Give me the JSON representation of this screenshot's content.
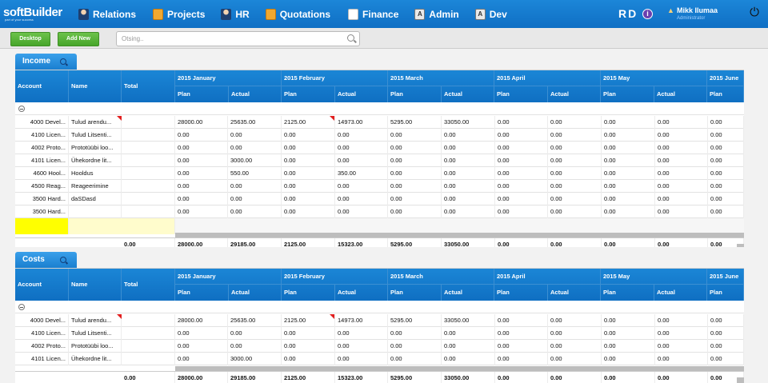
{
  "brand": {
    "name": "softBuilder",
    "tagline": "part of your success"
  },
  "nav": {
    "items": [
      {
        "label": "Relations",
        "icon": "person-icon"
      },
      {
        "label": "Projects",
        "icon": "projects-icon"
      },
      {
        "label": "HR",
        "icon": "person-icon"
      },
      {
        "label": "Quotations",
        "icon": "quotations-icon"
      },
      {
        "label": "Finance",
        "icon": "document-icon"
      },
      {
        "label": "Admin",
        "icon": "admin-icon"
      },
      {
        "label": "Dev",
        "icon": "dev-icon"
      }
    ],
    "initials": "RD",
    "info_glyph": "i",
    "user_name": "Mikk Ilumaa",
    "user_role": "Administrator"
  },
  "toolbar": {
    "desktop_label": "Desktop",
    "add_new_label": "Add New",
    "search_placeholder": "Otsing.."
  },
  "income": {
    "title": "Income",
    "headers": {
      "account": "Account",
      "name": "Name",
      "total": "Total",
      "months": [
        "2015 January",
        "2015 February",
        "2015 March",
        "2015 April",
        "2015 May",
        "2015 June"
      ],
      "plan": "Plan",
      "actual": "Actual"
    },
    "rows": [
      {
        "account": "4000 Devel...",
        "name": "Tulud arendu...",
        "total": "",
        "values": [
          "28000.00",
          "25635.00",
          "2125.00",
          "14973.00",
          "5295.00",
          "33050.00",
          "0.00",
          "0.00",
          "0.00",
          "0.00",
          "0.00"
        ]
      },
      {
        "account": "4100 Licen...",
        "name": "Tulud Litsenti...",
        "total": "",
        "values": [
          "0.00",
          "0.00",
          "0.00",
          "0.00",
          "0.00",
          "0.00",
          "0.00",
          "0.00",
          "0.00",
          "0.00",
          "0.00"
        ]
      },
      {
        "account": "4002 Proto...",
        "name": "Prototüübi loo...",
        "total": "",
        "values": [
          "0.00",
          "0.00",
          "0.00",
          "0.00",
          "0.00",
          "0.00",
          "0.00",
          "0.00",
          "0.00",
          "0.00",
          "0.00"
        ]
      },
      {
        "account": "4101 Licen...",
        "name": "Ühekordne lit...",
        "total": "",
        "values": [
          "0.00",
          "3000.00",
          "0.00",
          "0.00",
          "0.00",
          "0.00",
          "0.00",
          "0.00",
          "0.00",
          "0.00",
          "0.00"
        ]
      },
      {
        "account": "4600 Hool...",
        "name": "Hooldus",
        "total": "",
        "values": [
          "0.00",
          "550.00",
          "0.00",
          "350.00",
          "0.00",
          "0.00",
          "0.00",
          "0.00",
          "0.00",
          "0.00",
          "0.00"
        ]
      },
      {
        "account": "4500 Reag...",
        "name": "Reageerimine",
        "total": "",
        "values": [
          "0.00",
          "0.00",
          "0.00",
          "0.00",
          "0.00",
          "0.00",
          "0.00",
          "0.00",
          "0.00",
          "0.00",
          "0.00"
        ]
      },
      {
        "account": "3500 Hard...",
        "name": "daSDasd",
        "total": "",
        "values": [
          "0.00",
          "0.00",
          "0.00",
          "0.00",
          "0.00",
          "0.00",
          "0.00",
          "0.00",
          "0.00",
          "0.00",
          "0.00"
        ]
      },
      {
        "account": "3500 Hard...",
        "name": "",
        "total": "",
        "values": [
          "0.00",
          "0.00",
          "0.00",
          "0.00",
          "0.00",
          "0.00",
          "0.00",
          "0.00",
          "0.00",
          "0.00",
          "0.00"
        ]
      }
    ],
    "totals": {
      "total": "0.00",
      "values": [
        "28000.00",
        "29185.00",
        "2125.00",
        "15323.00",
        "5295.00",
        "33050.00",
        "0.00",
        "0.00",
        "0.00",
        "0.00",
        "0.00"
      ]
    }
  },
  "costs": {
    "title": "Costs",
    "headers": {
      "account": "Account",
      "name": "Name",
      "total": "Total",
      "months": [
        "2015 January",
        "2015 February",
        "2015 March",
        "2015 April",
        "2015 May",
        "2015 June"
      ],
      "plan": "Plan",
      "actual": "Actual"
    },
    "rows": [
      {
        "account": "4000 Devel...",
        "name": "Tulud arendu...",
        "total": "",
        "values": [
          "28000.00",
          "25635.00",
          "2125.00",
          "14973.00",
          "5295.00",
          "33050.00",
          "0.00",
          "0.00",
          "0.00",
          "0.00",
          "0.00"
        ]
      },
      {
        "account": "4100 Licen...",
        "name": "Tulud Litsenti...",
        "total": "",
        "values": [
          "0.00",
          "0.00",
          "0.00",
          "0.00",
          "0.00",
          "0.00",
          "0.00",
          "0.00",
          "0.00",
          "0.00",
          "0.00"
        ]
      },
      {
        "account": "4002 Proto...",
        "name": "Prototüübi loo...",
        "total": "",
        "values": [
          "0.00",
          "0.00",
          "0.00",
          "0.00",
          "0.00",
          "0.00",
          "0.00",
          "0.00",
          "0.00",
          "0.00",
          "0.00"
        ]
      },
      {
        "account": "4101 Licen...",
        "name": "Ühekordne lit...",
        "total": "",
        "values": [
          "0.00",
          "3000.00",
          "0.00",
          "0.00",
          "0.00",
          "0.00",
          "0.00",
          "0.00",
          "0.00",
          "0.00",
          "0.00"
        ]
      }
    ],
    "totals": {
      "total": "0.00",
      "values": [
        "28000.00",
        "29185.00",
        "2125.00",
        "15323.00",
        "5295.00",
        "33050.00",
        "0.00",
        "0.00",
        "0.00",
        "0.00",
        "0.00"
      ]
    }
  }
}
